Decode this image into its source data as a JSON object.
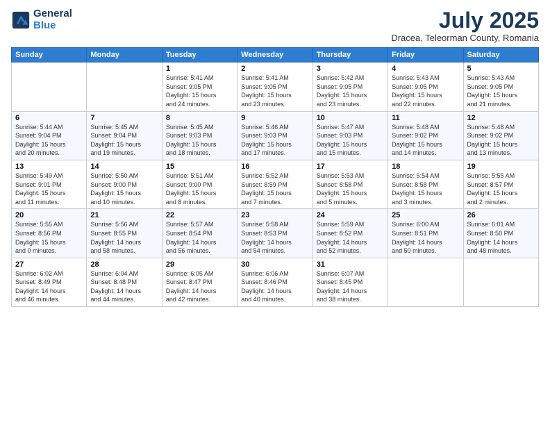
{
  "logo": {
    "general": "General",
    "blue": "Blue"
  },
  "header": {
    "month": "July 2025",
    "location": "Dracea, Teleorman County, Romania"
  },
  "weekdays": [
    "Sunday",
    "Monday",
    "Tuesday",
    "Wednesday",
    "Thursday",
    "Friday",
    "Saturday"
  ],
  "weeks": [
    [
      {
        "day": "",
        "info": ""
      },
      {
        "day": "",
        "info": ""
      },
      {
        "day": "1",
        "info": "Sunrise: 5:41 AM\nSunset: 9:05 PM\nDaylight: 15 hours\nand 24 minutes."
      },
      {
        "day": "2",
        "info": "Sunrise: 5:41 AM\nSunset: 9:05 PM\nDaylight: 15 hours\nand 23 minutes."
      },
      {
        "day": "3",
        "info": "Sunrise: 5:42 AM\nSunset: 9:05 PM\nDaylight: 15 hours\nand 23 minutes."
      },
      {
        "day": "4",
        "info": "Sunrise: 5:43 AM\nSunset: 9:05 PM\nDaylight: 15 hours\nand 22 minutes."
      },
      {
        "day": "5",
        "info": "Sunrise: 5:43 AM\nSunset: 9:05 PM\nDaylight: 15 hours\nand 21 minutes."
      }
    ],
    [
      {
        "day": "6",
        "info": "Sunrise: 5:44 AM\nSunset: 9:04 PM\nDaylight: 15 hours\nand 20 minutes."
      },
      {
        "day": "7",
        "info": "Sunrise: 5:45 AM\nSunset: 9:04 PM\nDaylight: 15 hours\nand 19 minutes."
      },
      {
        "day": "8",
        "info": "Sunrise: 5:45 AM\nSunset: 9:03 PM\nDaylight: 15 hours\nand 18 minutes."
      },
      {
        "day": "9",
        "info": "Sunrise: 5:46 AM\nSunset: 9:03 PM\nDaylight: 15 hours\nand 17 minutes."
      },
      {
        "day": "10",
        "info": "Sunrise: 5:47 AM\nSunset: 9:03 PM\nDaylight: 15 hours\nand 15 minutes."
      },
      {
        "day": "11",
        "info": "Sunrise: 5:48 AM\nSunset: 9:02 PM\nDaylight: 15 hours\nand 14 minutes."
      },
      {
        "day": "12",
        "info": "Sunrise: 5:48 AM\nSunset: 9:02 PM\nDaylight: 15 hours\nand 13 minutes."
      }
    ],
    [
      {
        "day": "13",
        "info": "Sunrise: 5:49 AM\nSunset: 9:01 PM\nDaylight: 15 hours\nand 11 minutes."
      },
      {
        "day": "14",
        "info": "Sunrise: 5:50 AM\nSunset: 9:00 PM\nDaylight: 15 hours\nand 10 minutes."
      },
      {
        "day": "15",
        "info": "Sunrise: 5:51 AM\nSunset: 9:00 PM\nDaylight: 15 hours\nand 8 minutes."
      },
      {
        "day": "16",
        "info": "Sunrise: 5:52 AM\nSunset: 8:59 PM\nDaylight: 15 hours\nand 7 minutes."
      },
      {
        "day": "17",
        "info": "Sunrise: 5:53 AM\nSunset: 8:58 PM\nDaylight: 15 hours\nand 5 minutes."
      },
      {
        "day": "18",
        "info": "Sunrise: 5:54 AM\nSunset: 8:58 PM\nDaylight: 15 hours\nand 3 minutes."
      },
      {
        "day": "19",
        "info": "Sunrise: 5:55 AM\nSunset: 8:57 PM\nDaylight: 15 hours\nand 2 minutes."
      }
    ],
    [
      {
        "day": "20",
        "info": "Sunrise: 5:55 AM\nSunset: 8:56 PM\nDaylight: 15 hours\nand 0 minutes."
      },
      {
        "day": "21",
        "info": "Sunrise: 5:56 AM\nSunset: 8:55 PM\nDaylight: 14 hours\nand 58 minutes."
      },
      {
        "day": "22",
        "info": "Sunrise: 5:57 AM\nSunset: 8:54 PM\nDaylight: 14 hours\nand 56 minutes."
      },
      {
        "day": "23",
        "info": "Sunrise: 5:58 AM\nSunset: 8:53 PM\nDaylight: 14 hours\nand 54 minutes."
      },
      {
        "day": "24",
        "info": "Sunrise: 5:59 AM\nSunset: 8:52 PM\nDaylight: 14 hours\nand 52 minutes."
      },
      {
        "day": "25",
        "info": "Sunrise: 6:00 AM\nSunset: 8:51 PM\nDaylight: 14 hours\nand 50 minutes."
      },
      {
        "day": "26",
        "info": "Sunrise: 6:01 AM\nSunset: 8:50 PM\nDaylight: 14 hours\nand 48 minutes."
      }
    ],
    [
      {
        "day": "27",
        "info": "Sunrise: 6:02 AM\nSunset: 8:49 PM\nDaylight: 14 hours\nand 46 minutes."
      },
      {
        "day": "28",
        "info": "Sunrise: 6:04 AM\nSunset: 8:48 PM\nDaylight: 14 hours\nand 44 minutes."
      },
      {
        "day": "29",
        "info": "Sunrise: 6:05 AM\nSunset: 8:47 PM\nDaylight: 14 hours\nand 42 minutes."
      },
      {
        "day": "30",
        "info": "Sunrise: 6:06 AM\nSunset: 8:46 PM\nDaylight: 14 hours\nand 40 minutes."
      },
      {
        "day": "31",
        "info": "Sunrise: 6:07 AM\nSunset: 8:45 PM\nDaylight: 14 hours\nand 38 minutes."
      },
      {
        "day": "",
        "info": ""
      },
      {
        "day": "",
        "info": ""
      }
    ]
  ]
}
